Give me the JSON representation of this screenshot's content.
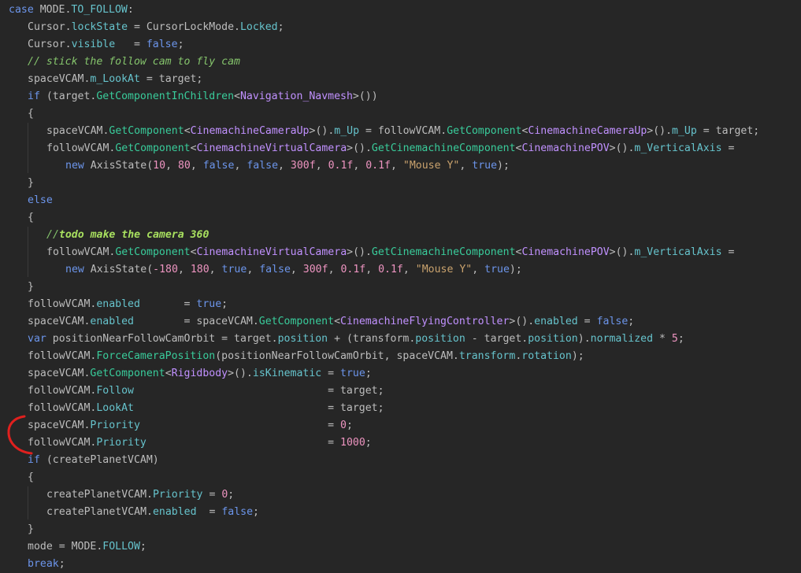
{
  "editor": {
    "lines": [
      {
        "indent": 0,
        "tokens": [
          [
            "kw",
            "case "
          ],
          [
            "var",
            "MODE."
          ],
          [
            "mem",
            "TO_FOLLOW"
          ],
          [
            "var",
            ":"
          ]
        ]
      },
      {
        "indent": 1,
        "tokens": [
          [
            "var",
            "Cursor."
          ],
          [
            "mem",
            "lockState"
          ],
          [
            "var",
            " = CursorLockMode."
          ],
          [
            "mem",
            "Locked"
          ],
          [
            "var",
            ";"
          ]
        ]
      },
      {
        "indent": 1,
        "tokens": [
          [
            "var",
            "Cursor."
          ],
          [
            "mem",
            "visible"
          ],
          [
            "var",
            "   = "
          ],
          [
            "kw",
            "false"
          ],
          [
            "var",
            ";"
          ]
        ]
      },
      {
        "indent": 1,
        "tokens": [
          [
            "com",
            "// stick the follow cam to fly cam"
          ]
        ]
      },
      {
        "indent": 1,
        "tokens": [
          [
            "var",
            "spaceVCAM."
          ],
          [
            "mem",
            "m_LookAt"
          ],
          [
            "var",
            " = target;"
          ]
        ]
      },
      {
        "indent": 1,
        "tokens": [
          [
            "kw",
            "if"
          ],
          [
            "var",
            " (target."
          ],
          [
            "meth",
            "GetComponentInChildren"
          ],
          [
            "var",
            "<"
          ],
          [
            "typ",
            "Navigation_Navmesh"
          ],
          [
            "var",
            ">())"
          ]
        ]
      },
      {
        "indent": 1,
        "tokens": [
          [
            "var",
            "{"
          ]
        ]
      },
      {
        "indent": 2,
        "tokens": [
          [
            "var",
            "spaceVCAM."
          ],
          [
            "meth",
            "GetComponent"
          ],
          [
            "var",
            "<"
          ],
          [
            "typ",
            "CinemachineCameraUp"
          ],
          [
            "var",
            ">()."
          ],
          [
            "mem",
            "m_Up"
          ],
          [
            "var",
            " = followVCAM."
          ],
          [
            "meth",
            "GetComponent"
          ],
          [
            "var",
            "<"
          ],
          [
            "typ",
            "CinemachineCameraUp"
          ],
          [
            "var",
            ">()."
          ],
          [
            "mem",
            "m_Up"
          ],
          [
            "var",
            " = target;"
          ]
        ]
      },
      {
        "indent": 2,
        "tokens": [
          [
            "var",
            "followVCAM."
          ],
          [
            "meth",
            "GetComponent"
          ],
          [
            "var",
            "<"
          ],
          [
            "typ",
            "CinemachineVirtualCamera"
          ],
          [
            "var",
            ">()."
          ],
          [
            "meth",
            "GetCinemachineComponent"
          ],
          [
            "var",
            "<"
          ],
          [
            "typ",
            "CinemachinePOV"
          ],
          [
            "var",
            ">()."
          ],
          [
            "mem",
            "m_VerticalAxis"
          ],
          [
            "var",
            " ="
          ]
        ]
      },
      {
        "indent": 3,
        "tokens": [
          [
            "kw",
            "new "
          ],
          [
            "var",
            "AxisState("
          ],
          [
            "num",
            "10"
          ],
          [
            "var",
            ", "
          ],
          [
            "num",
            "80"
          ],
          [
            "var",
            ", "
          ],
          [
            "kw",
            "false"
          ],
          [
            "var",
            ", "
          ],
          [
            "kw",
            "false"
          ],
          [
            "var",
            ", "
          ],
          [
            "num",
            "300f"
          ],
          [
            "var",
            ", "
          ],
          [
            "num",
            "0.1f"
          ],
          [
            "var",
            ", "
          ],
          [
            "num",
            "0.1f"
          ],
          [
            "var",
            ", "
          ],
          [
            "str",
            "\"Mouse Y\""
          ],
          [
            "var",
            ", "
          ],
          [
            "kw",
            "true"
          ],
          [
            "var",
            ");"
          ]
        ]
      },
      {
        "indent": 1,
        "tokens": [
          [
            "var",
            "}"
          ]
        ]
      },
      {
        "indent": 1,
        "tokens": [
          [
            "kw",
            "else"
          ]
        ]
      },
      {
        "indent": 1,
        "tokens": [
          [
            "var",
            "{"
          ]
        ]
      },
      {
        "indent": 2,
        "tokens": [
          [
            "com",
            "//"
          ],
          [
            "todo",
            "todo make the camera 360"
          ]
        ]
      },
      {
        "indent": 2,
        "tokens": [
          [
            "var",
            "followVCAM."
          ],
          [
            "meth",
            "GetComponent"
          ],
          [
            "var",
            "<"
          ],
          [
            "typ",
            "CinemachineVirtualCamera"
          ],
          [
            "var",
            ">()."
          ],
          [
            "meth",
            "GetCinemachineComponent"
          ],
          [
            "var",
            "<"
          ],
          [
            "typ",
            "CinemachinePOV"
          ],
          [
            "var",
            ">()."
          ],
          [
            "mem",
            "m_VerticalAxis"
          ],
          [
            "var",
            " ="
          ]
        ]
      },
      {
        "indent": 3,
        "tokens": [
          [
            "kw",
            "new "
          ],
          [
            "var",
            "AxisState("
          ],
          [
            "num",
            "-180"
          ],
          [
            "var",
            ", "
          ],
          [
            "num",
            "180"
          ],
          [
            "var",
            ", "
          ],
          [
            "kw",
            "true"
          ],
          [
            "var",
            ", "
          ],
          [
            "kw",
            "false"
          ],
          [
            "var",
            ", "
          ],
          [
            "num",
            "300f"
          ],
          [
            "var",
            ", "
          ],
          [
            "num",
            "0.1f"
          ],
          [
            "var",
            ", "
          ],
          [
            "num",
            "0.1f"
          ],
          [
            "var",
            ", "
          ],
          [
            "str",
            "\"Mouse Y\""
          ],
          [
            "var",
            ", "
          ],
          [
            "kw",
            "true"
          ],
          [
            "var",
            ");"
          ]
        ]
      },
      {
        "indent": 1,
        "tokens": [
          [
            "var",
            "}"
          ]
        ]
      },
      {
        "indent": 1,
        "tokens": [
          [
            "var",
            "followVCAM."
          ],
          [
            "mem",
            "enabled"
          ],
          [
            "var",
            "       = "
          ],
          [
            "kw",
            "true"
          ],
          [
            "var",
            ";"
          ]
        ]
      },
      {
        "indent": 1,
        "tokens": [
          [
            "var",
            "spaceVCAM."
          ],
          [
            "mem",
            "enabled"
          ],
          [
            "var",
            "        = spaceVCAM."
          ],
          [
            "meth",
            "GetComponent"
          ],
          [
            "var",
            "<"
          ],
          [
            "typ",
            "CinemachineFlyingController"
          ],
          [
            "var",
            ">()."
          ],
          [
            "mem",
            "enabled"
          ],
          [
            "var",
            " = "
          ],
          [
            "kw",
            "false"
          ],
          [
            "var",
            ";"
          ]
        ]
      },
      {
        "indent": 1,
        "tokens": [
          [
            "kw",
            "var"
          ],
          [
            "var",
            " positionNearFollowCamOrbit = target."
          ],
          [
            "mem",
            "position"
          ],
          [
            "var",
            " + (transform."
          ],
          [
            "mem",
            "position"
          ],
          [
            "var",
            " - target."
          ],
          [
            "mem",
            "position"
          ],
          [
            "var",
            ")."
          ],
          [
            "mem",
            "normalized"
          ],
          [
            "var",
            " * "
          ],
          [
            "num",
            "5"
          ],
          [
            "var",
            ";"
          ]
        ]
      },
      {
        "indent": 1,
        "tokens": [
          [
            "var",
            "followVCAM."
          ],
          [
            "meth",
            "ForceCameraPosition"
          ],
          [
            "var",
            "(positionNearFollowCamOrbit, spaceVCAM."
          ],
          [
            "mem",
            "transform"
          ],
          [
            "var",
            "."
          ],
          [
            "mem",
            "rotation"
          ],
          [
            "var",
            ");"
          ]
        ]
      },
      {
        "indent": 1,
        "tokens": [
          [
            "var",
            "spaceVCAM."
          ],
          [
            "meth",
            "GetComponent"
          ],
          [
            "var",
            "<"
          ],
          [
            "typ",
            "Rigidbody"
          ],
          [
            "var",
            ">()."
          ],
          [
            "mem",
            "isKinematic"
          ],
          [
            "var",
            " = "
          ],
          [
            "kw",
            "true"
          ],
          [
            "var",
            ";"
          ]
        ]
      },
      {
        "indent": 1,
        "tokens": [
          [
            "var",
            "followVCAM."
          ],
          [
            "mem",
            "Follow"
          ],
          [
            "var",
            "                               = target;"
          ]
        ]
      },
      {
        "indent": 1,
        "tokens": [
          [
            "var",
            "followVCAM."
          ],
          [
            "mem",
            "LookAt"
          ],
          [
            "var",
            "                               = target;"
          ]
        ]
      },
      {
        "indent": 1,
        "tokens": [
          [
            "var",
            "spaceVCAM."
          ],
          [
            "mem",
            "Priority"
          ],
          [
            "var",
            "                              = "
          ],
          [
            "num",
            "0"
          ],
          [
            "var",
            ";"
          ]
        ]
      },
      {
        "indent": 1,
        "tokens": [
          [
            "var",
            "followVCAM."
          ],
          [
            "mem",
            "Priority"
          ],
          [
            "var",
            "                             = "
          ],
          [
            "num",
            "1000"
          ],
          [
            "var",
            ";"
          ]
        ]
      },
      {
        "indent": 1,
        "tokens": [
          [
            "kw",
            "if"
          ],
          [
            "var",
            " (createPlanetVCAM)"
          ]
        ]
      },
      {
        "indent": 1,
        "tokens": [
          [
            "var",
            "{"
          ]
        ]
      },
      {
        "indent": 2,
        "tokens": [
          [
            "var",
            "createPlanetVCAM."
          ],
          [
            "mem",
            "Priority"
          ],
          [
            "var",
            " = "
          ],
          [
            "num",
            "0"
          ],
          [
            "var",
            ";"
          ]
        ]
      },
      {
        "indent": 2,
        "tokens": [
          [
            "var",
            "createPlanetVCAM."
          ],
          [
            "mem",
            "enabled"
          ],
          [
            "var",
            "  = "
          ],
          [
            "kw",
            "false"
          ],
          [
            "var",
            ";"
          ]
        ]
      },
      {
        "indent": 1,
        "tokens": [
          [
            "var",
            "}"
          ]
        ]
      },
      {
        "indent": 1,
        "tokens": [
          [
            "var",
            "mode = MODE."
          ],
          [
            "mem",
            "FOLLOW"
          ],
          [
            "var",
            ";"
          ]
        ]
      },
      {
        "indent": 1,
        "tokens": [
          [
            "kw",
            "break"
          ],
          [
            "var",
            ";"
          ]
        ]
      }
    ]
  },
  "colors": {
    "background": "#262626",
    "keyword": "#6c95eb",
    "type": "#c191ff",
    "member": "#66c3cc",
    "method": "#39cc9b",
    "number": "#ed94c0",
    "string": "#c9a26d",
    "comment": "#85c46c",
    "annotation": "#e0201e"
  },
  "annotation": {
    "shape": "bracket",
    "color": "#e0201e"
  }
}
